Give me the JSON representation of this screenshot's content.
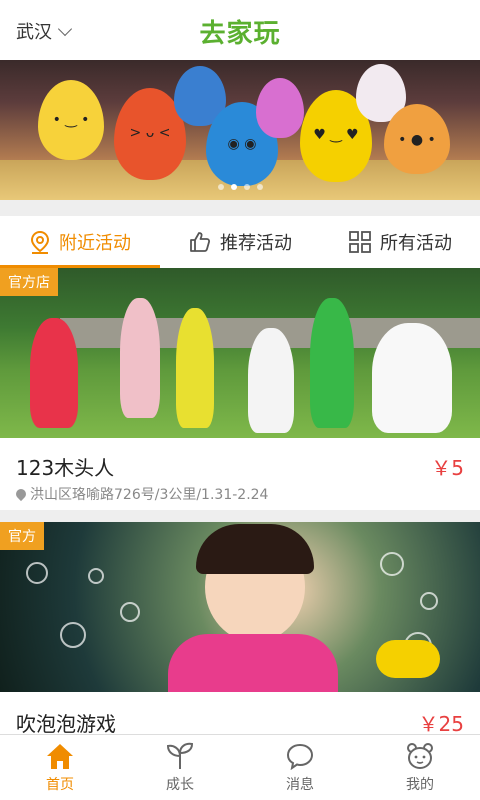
{
  "header": {
    "city": "武汉",
    "logo": "去家玩"
  },
  "banner": {
    "slides": 4,
    "active_slide": 2
  },
  "tabs": [
    {
      "label": "附近活动",
      "icon": "location-pin-icon",
      "active": true
    },
    {
      "label": "推荐活动",
      "icon": "thumbs-up-icon",
      "active": false
    },
    {
      "label": "所有活动",
      "icon": "grid-icon",
      "active": false
    }
  ],
  "activities": [
    {
      "badge": "官方店",
      "title": "123木头人",
      "price": "￥5",
      "meta": "洪山区珞喻路726号/3公里/1.31-2.24"
    },
    {
      "badge": "官方",
      "title": "吹泡泡游戏",
      "price": "￥25"
    }
  ],
  "bottom_nav": [
    {
      "label": "首页",
      "icon": "home-icon",
      "active": true
    },
    {
      "label": "成长",
      "icon": "sprout-icon",
      "active": false
    },
    {
      "label": "消息",
      "icon": "chat-bubble-icon",
      "active": false
    },
    {
      "label": "我的",
      "icon": "bear-face-icon",
      "active": false
    }
  ],
  "colors": {
    "accent": "#f08c00",
    "logo": "#5bb030",
    "price": "#e84040",
    "badge": "#f0a020"
  }
}
